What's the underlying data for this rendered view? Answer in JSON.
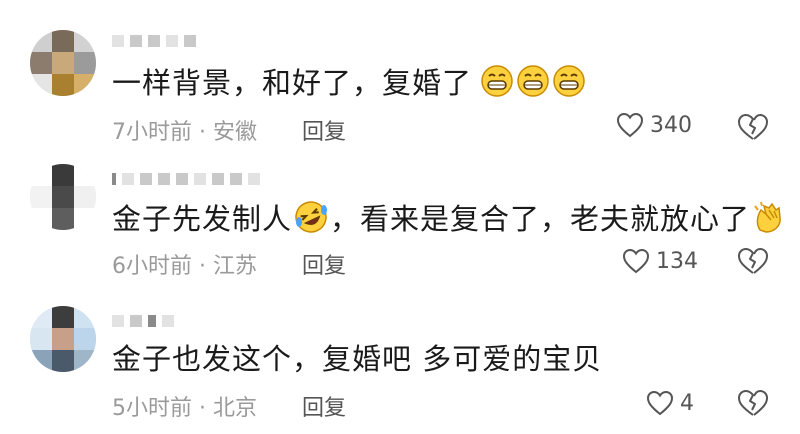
{
  "comments": [
    {
      "text": "一样背景，和好了，复婚了",
      "emojis": [
        "grinning-face-icon",
        "grinning-face-icon",
        "grinning-face-icon"
      ],
      "time": "7小时前",
      "location": "安徽",
      "reply_label": "回复",
      "likes": "340"
    },
    {
      "text_part1": "金子先发制人",
      "text_part2": "，看来是复合了，老夫就放心了",
      "emojis": [
        "rolling-laughing-face-icon",
        "clapping-hands-icon"
      ],
      "time": "6小时前",
      "location": "江苏",
      "reply_label": "回复",
      "likes": "134"
    },
    {
      "text": "金子也发这个，复婚吧 多可爱的宝贝",
      "time": "5小时前",
      "location": "北京",
      "reply_label": "回复",
      "likes": "4"
    }
  ],
  "meta_separator": "·",
  "colors": {
    "text": "#1a1a1a",
    "meta": "#9a9a9a",
    "emoji_face": "#fcd13d",
    "emoji_outline": "#c98a00"
  }
}
